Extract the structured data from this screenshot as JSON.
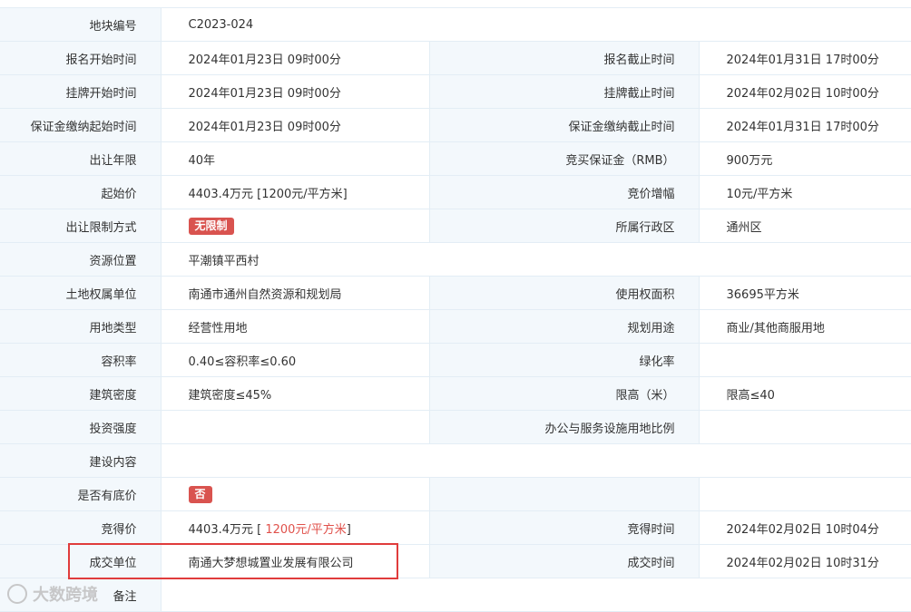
{
  "rows": [
    {
      "l1": "地块编号",
      "v1": "C2023-024",
      "l2": "",
      "v2": ""
    },
    {
      "l1": "报名开始时间",
      "v1": "2024年01月23日 09时00分",
      "l2": "报名截止时间",
      "v2": "2024年01月31日 17时00分"
    },
    {
      "l1": "挂牌开始时间",
      "v1": "2024年01月23日 09时00分",
      "l2": "挂牌截止时间",
      "v2": "2024年02月02日 10时00分"
    },
    {
      "l1": "保证金缴纳起始时间",
      "v1": "2024年01月23日 09时00分",
      "l2": "保证金缴纳截止时间",
      "v2": "2024年01月31日 17时00分"
    },
    {
      "l1": "出让年限",
      "v1": "40年",
      "l2": "竞买保证金（RMB）",
      "v2": "900万元"
    },
    {
      "l1": "起始价",
      "v1": "4403.4万元 [1200元/平方米]",
      "l2": "竞价增幅",
      "v2": "10元/平方米"
    },
    {
      "l1": "出让限制方式",
      "v1": "无限制",
      "l2": "所属行政区",
      "v2": "通州区"
    },
    {
      "l1": "资源位置",
      "v1": "平潮镇平西村",
      "l2": "",
      "v2": ""
    },
    {
      "l1": "土地权属单位",
      "v1": "南通市通州自然资源和规划局",
      "l2": "使用权面积",
      "v2": "36695平方米"
    },
    {
      "l1": "用地类型",
      "v1": "经营性用地",
      "l2": "规划用途",
      "v2": "商业/其他商服用地"
    },
    {
      "l1": "容积率",
      "v1": "0.40≤容积率≤0.60",
      "l2": "绿化率",
      "v2": ""
    },
    {
      "l1": "建筑密度",
      "v1": "建筑密度≤45%",
      "l2": "限高（米）",
      "v2": "限高≤40"
    },
    {
      "l1": "投资强度",
      "v1": "",
      "l2": "办公与服务设施用地比例",
      "v2": ""
    },
    {
      "l1": "建设内容",
      "v1": "",
      "l2": "",
      "v2": ""
    },
    {
      "l1": "是否有底价",
      "v1": "否",
      "l2": "",
      "v2": ""
    },
    {
      "l1": "竞得价",
      "v1a": "4403.4万元 [ ",
      "v1b": "1200元/平方米",
      "v1c": "]",
      "l2": "竞得时间",
      "v2": "2024年02月02日 10时04分"
    },
    {
      "l1": "成交单位",
      "v1": "南通大梦想城置业发展有限公司",
      "l2": "成交时间",
      "v2": "2024年02月02日 10时31分"
    },
    {
      "l1": "备注",
      "v1": "",
      "l2": "",
      "v2": ""
    }
  ],
  "watermark": "大数跨境",
  "colors": {
    "badge": "#d9534f",
    "price_highlight": "#e0504a",
    "box": "#e03c3c"
  }
}
